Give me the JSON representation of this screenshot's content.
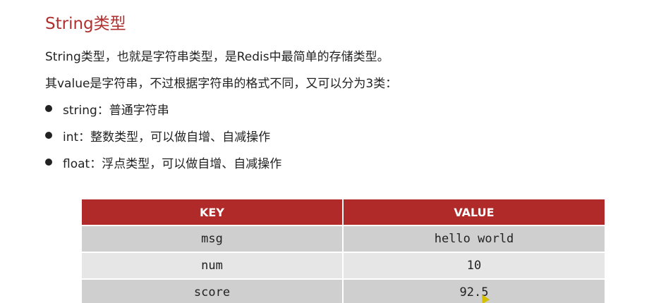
{
  "title": "String类型",
  "intro": "String类型，也就是字符串类型，是Redis中最简单的存储类型。",
  "subtitle": "其value是字符串，不过根据字符串的格式不同，又可以分为3类：",
  "bullets": [
    {
      "text": "string：普通字符串"
    },
    {
      "text": "int：整数类型，可以做自增、自减操作"
    },
    {
      "text": "float：浮点类型，可以做自增、自减操作"
    }
  ],
  "table": {
    "headers": {
      "key": "KEY",
      "value": "VALUE"
    },
    "rows": [
      {
        "key": "msg",
        "value": "hello world"
      },
      {
        "key": "num",
        "value": "10"
      },
      {
        "key": "score",
        "value": "92.5"
      }
    ]
  },
  "colors": {
    "accent": "#b03030",
    "header_bg": "#b02a2a",
    "row_dark": "#cfcfcf",
    "row_light": "#e6e6e6"
  }
}
